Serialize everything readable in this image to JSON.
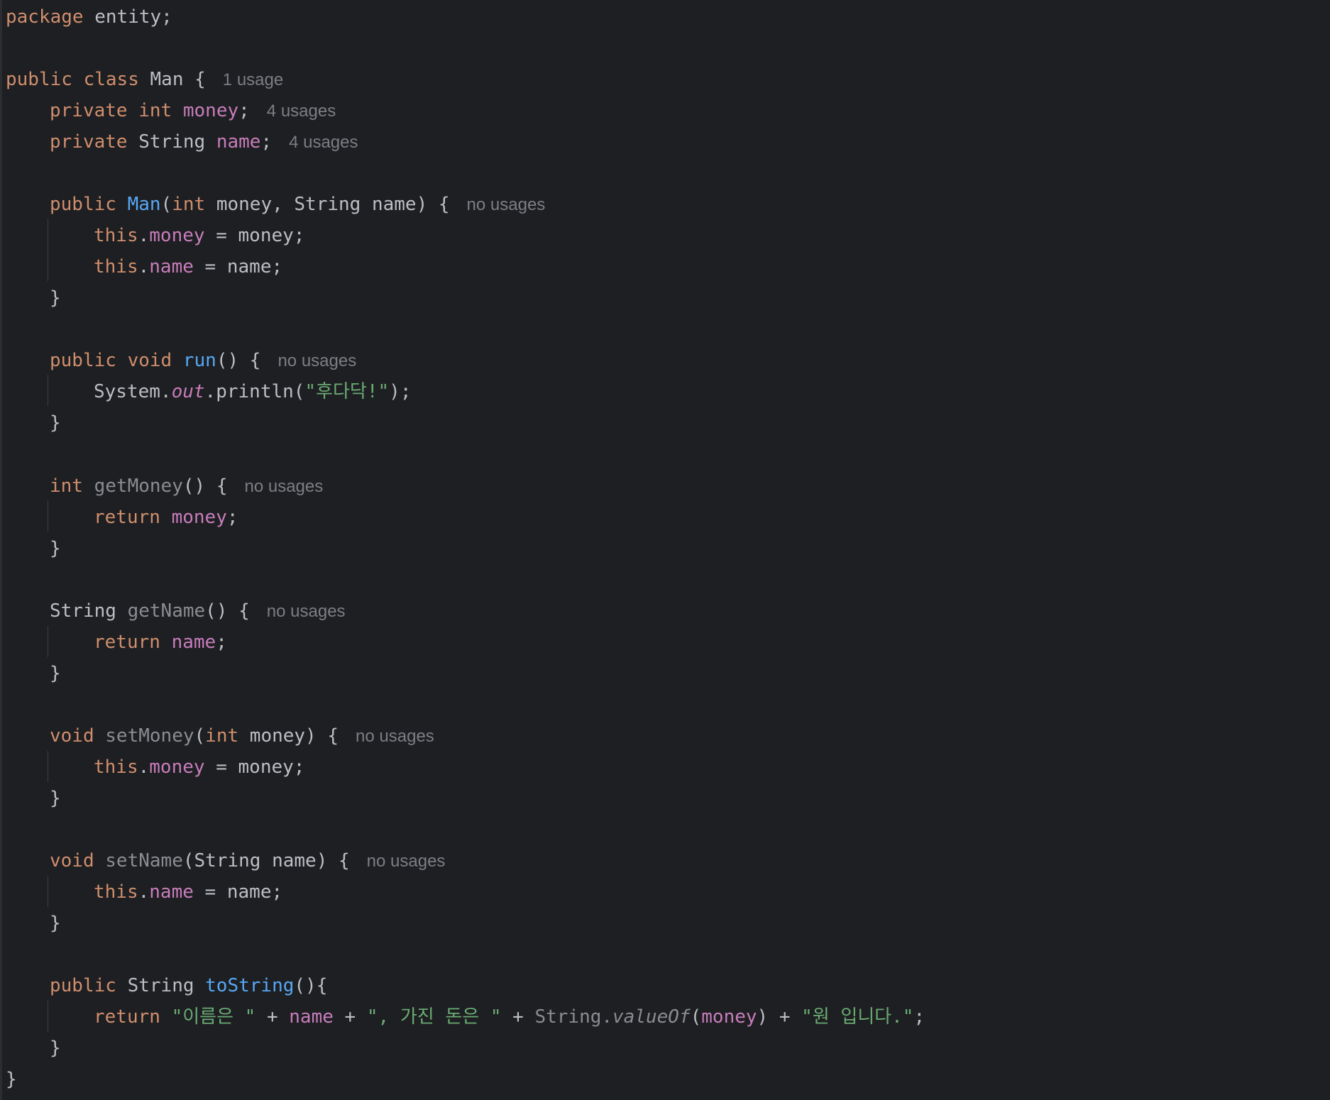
{
  "code": {
    "package_kw": "package",
    "package_name": "entity;",
    "class_decl": {
      "kw_public": "public",
      "kw_class": "class",
      "name": "Man",
      "brace": "{",
      "usage_hint": "1 usage"
    },
    "field_money": {
      "kw_private": "private",
      "type": "int",
      "name": "money",
      "semi": ";",
      "usage_hint": "4 usages"
    },
    "field_name": {
      "kw_private": "private",
      "type": "String",
      "name": "name",
      "semi": ";",
      "usage_hint": "4 usages"
    },
    "constructor": {
      "kw_public": "public",
      "name": "Man",
      "open_paren": "(",
      "param1_type": "int",
      "params_rest": " money, String name) {",
      "usage_hint": "no usages",
      "body": [
        {
          "kw": "this",
          "dot": ".",
          "field": "money",
          "rest": " = money;"
        },
        {
          "kw": "this",
          "dot": ".",
          "field": "name",
          "rest": " = name;"
        }
      ],
      "close": "}"
    },
    "run_method": {
      "kw_public": "public",
      "kw_void": "void",
      "name": "run",
      "signature_rest": "() {",
      "usage_hint": "no usages",
      "body_prefix": "System.",
      "body_static_field": "out",
      "body_call": ".println(",
      "body_string": "\"후다닥!\"",
      "body_suffix": ");",
      "close": "}"
    },
    "get_money": {
      "kw_type": "int",
      "name": "getMoney",
      "signature_rest": "() {",
      "usage_hint": "no usages",
      "kw_return": "return",
      "return_field": "money",
      "return_semi": ";",
      "close": "}"
    },
    "get_name": {
      "type": "String",
      "name": "getName",
      "signature_rest": "() {",
      "usage_hint": "no usages",
      "kw_return": "return",
      "return_field": "name",
      "return_semi": ";",
      "close": "}"
    },
    "set_money": {
      "kw_void": "void",
      "name": "setMoney",
      "open_paren": "(",
      "param_type_kw": "int",
      "params_rest": " money) {",
      "usage_hint": "no usages",
      "body_kw": "this",
      "body_dot": ".",
      "body_field": "money",
      "body_rest": " = money;",
      "close": "}"
    },
    "set_name": {
      "kw_void": "void",
      "name": "setName",
      "params_rest": "(String name) {",
      "usage_hint": "no usages",
      "body_kw": "this",
      "body_dot": ".",
      "body_field": "name",
      "body_rest": " = name;",
      "close": "}"
    },
    "to_string": {
      "kw_public": "public",
      "type": "String",
      "name": "toString",
      "signature_rest": "(){",
      "kw_return": "return",
      "str1": "\"이름은 \"",
      "plus1": " + ",
      "field1": "name",
      "plus2": " + ",
      "str2": "\", 가진 돈은 \"",
      "plus3": " + ",
      "cls": "String.",
      "static_call": "valueOf",
      "open_paren": "(",
      "field2": "money",
      "close_paren": ")",
      "plus4": " + ",
      "str3": "\"원 입니다.\"",
      "semi": ";",
      "close": "}"
    },
    "class_close": "}"
  }
}
